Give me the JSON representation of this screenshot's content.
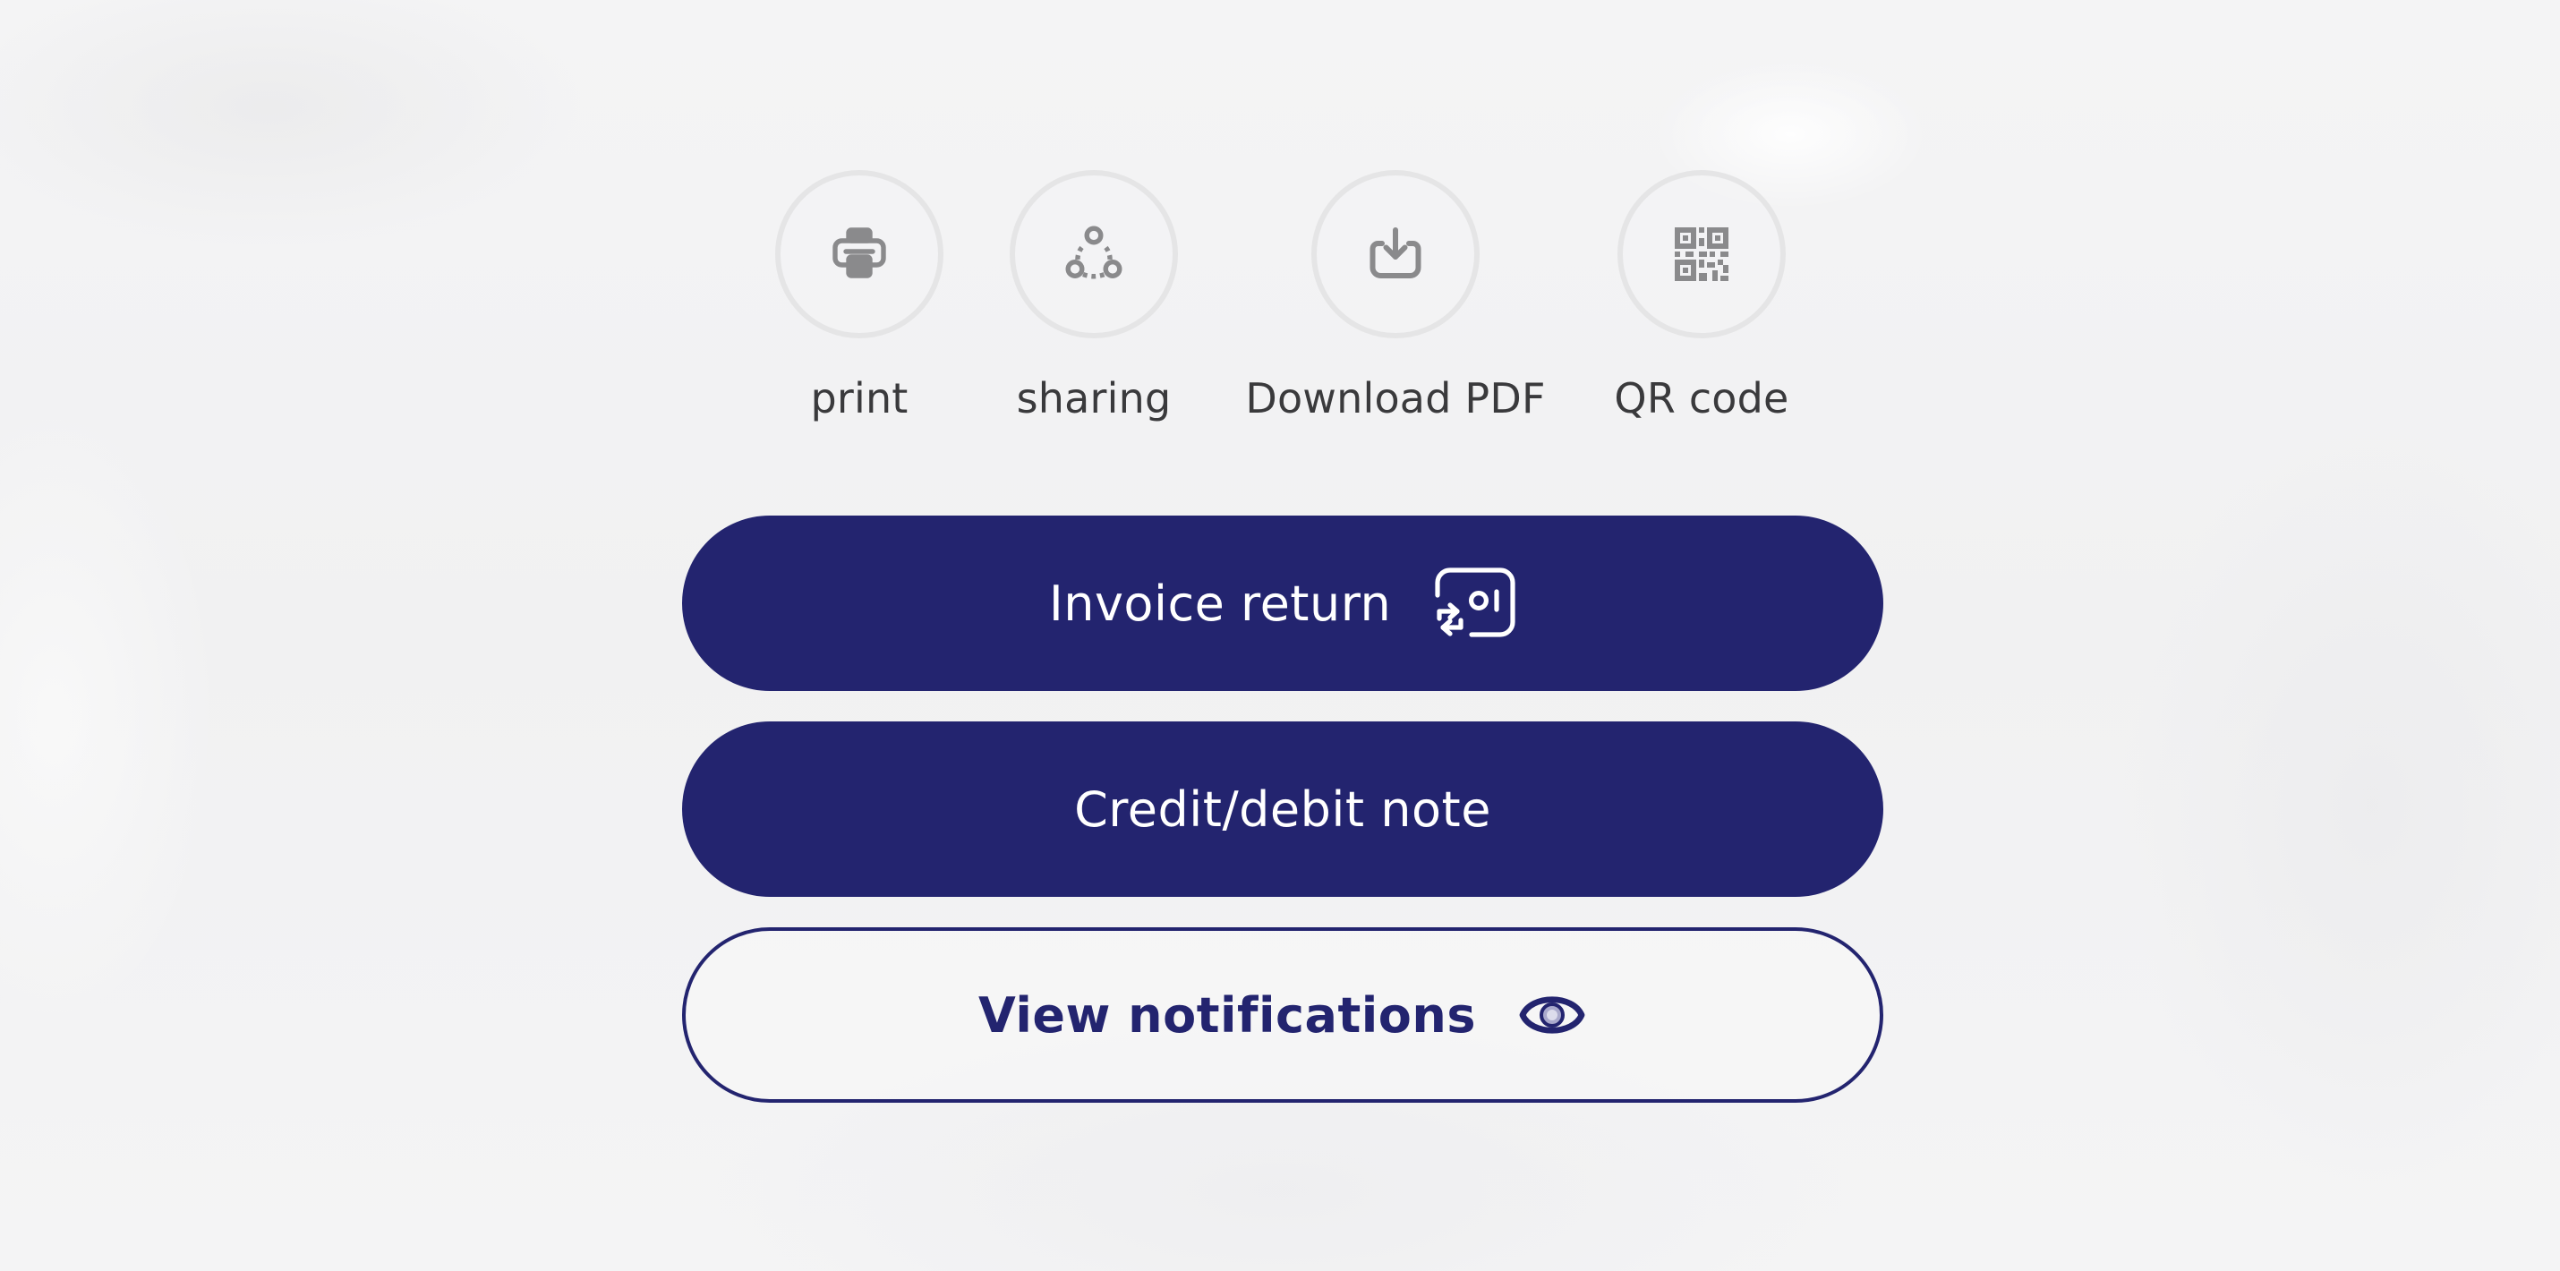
{
  "actions": [
    {
      "id": "print",
      "label": "print",
      "icon": "printer-icon"
    },
    {
      "id": "sharing",
      "label": "sharing",
      "icon": "share-nodes-icon"
    },
    {
      "id": "download_pdf",
      "label": "Download PDF",
      "icon": "download-icon"
    },
    {
      "id": "qr_code",
      "label": "QR code",
      "icon": "qr-code-icon"
    }
  ],
  "buttons": {
    "invoice_return": {
      "label": "Invoice return",
      "icon": "return-receipt-icon"
    },
    "credit_debit_note": {
      "label": "Credit/debit note"
    },
    "view_notifications": {
      "label": "View notifications",
      "icon": "eye-icon"
    }
  },
  "colors": {
    "primary": "#23246f",
    "icon_gray": "#8a8a8c",
    "label_text": "#3a3a3c",
    "circle_border": "#e5e5e6",
    "background": "#f3f3f4"
  }
}
